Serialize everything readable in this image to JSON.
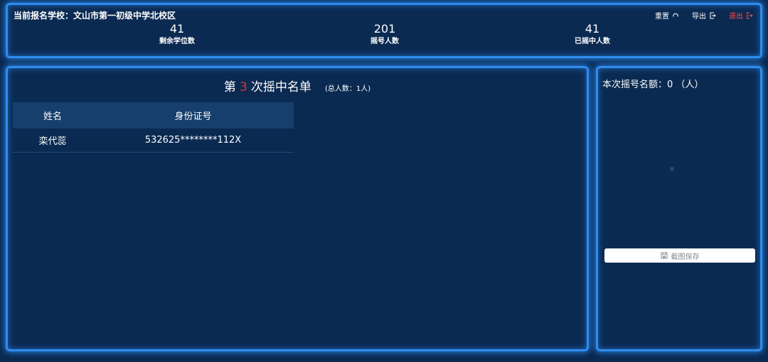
{
  "header": {
    "school_title": "当前报名学校：文山市第一初级中学北校区",
    "actions": {
      "reset_label": "重置",
      "export_label": "导出",
      "logout_label": "退出"
    }
  },
  "stats": [
    {
      "value": "41",
      "label": "剩余学位数"
    },
    {
      "value": "201",
      "label": "摇号人数"
    },
    {
      "value": "41",
      "label": "已摇中人数"
    }
  ],
  "list": {
    "title_prefix": "第",
    "round_number": "3",
    "title_suffix": "次摇中名单",
    "total_text": "(总人数：1人)",
    "columns": [
      "姓名",
      "身份证号"
    ],
    "rows": [
      {
        "name": "栾代蕊",
        "id_number": "532625********112X"
      }
    ]
  },
  "side": {
    "quota_text": "本次摇号名额：0 （人）",
    "save_label": "截图保存"
  },
  "colors": {
    "background": "#0a2a52",
    "border_glow": "#2f8cf0",
    "accent_red": "#e0323a",
    "logout_red": "#ff4d4f"
  },
  "icons": {
    "reset": "refresh-icon",
    "export": "export-icon",
    "logout": "logout-icon",
    "save": "save-icon"
  }
}
